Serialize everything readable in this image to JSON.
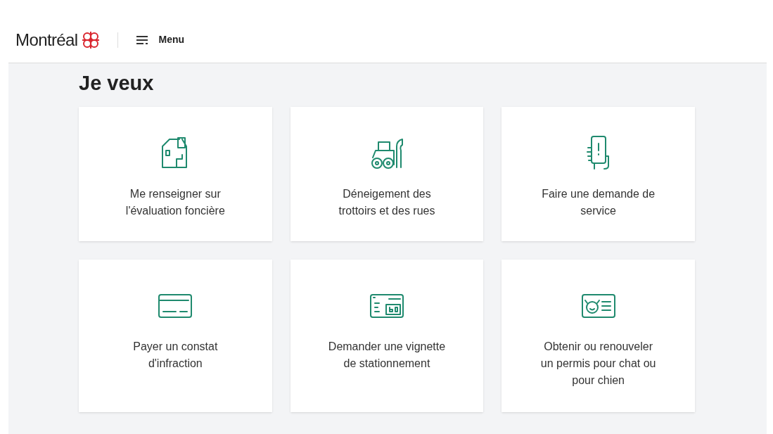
{
  "header": {
    "logo": "Montréal",
    "menu": "Menu"
  },
  "title": "Je veux",
  "cards": [
    {
      "kind": "house",
      "label": "Me renseigner sur l'évaluation foncière"
    },
    {
      "kind": "plow",
      "label": "Déneigement des trottoirs et des rues"
    },
    {
      "kind": "phone",
      "label": "Faire une demande de service"
    },
    {
      "kind": "card",
      "label": "Payer un constat d'infraction"
    },
    {
      "kind": "sticker",
      "label": "Demander une vignette de stationnement"
    },
    {
      "kind": "petid",
      "label": "Obtenir ou renouveler un permis pour chat ou pour chien"
    }
  ]
}
